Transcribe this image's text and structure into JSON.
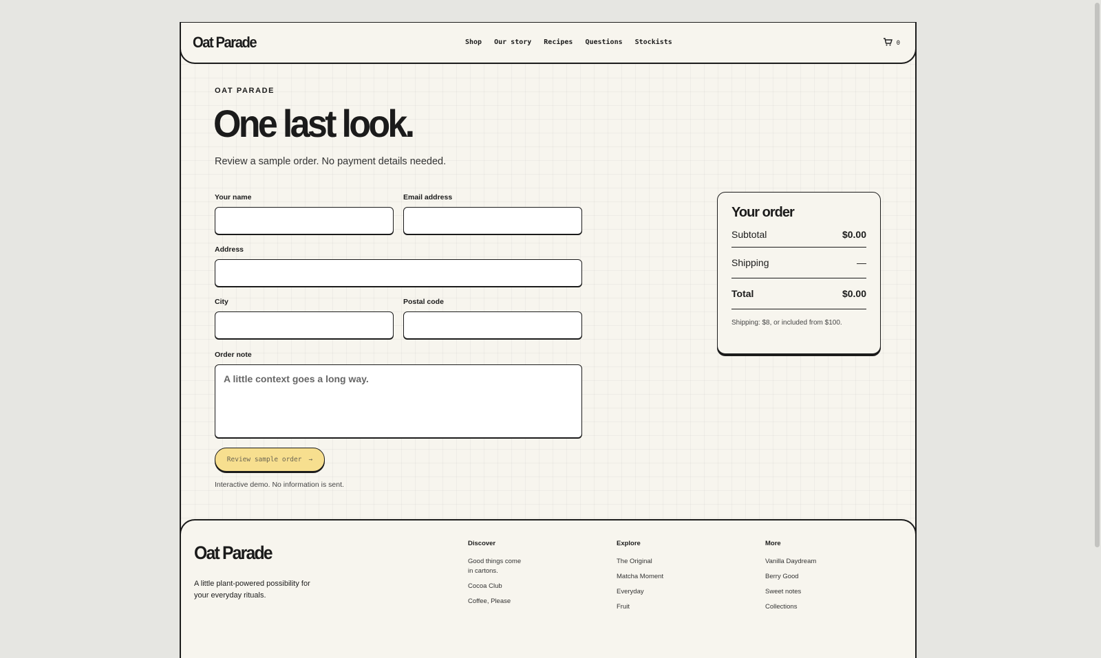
{
  "header": {
    "logo": "Oat Parade",
    "nav": [
      "Shop",
      "Our story",
      "Recipes",
      "Questions",
      "Stockists"
    ],
    "cart_count": "0"
  },
  "checkout": {
    "eyebrow": "OAT PARADE",
    "title": "One last look.",
    "subtitle": "Review a sample order. No payment details needed.",
    "fields": {
      "name_label": "Your name",
      "email_label": "Email address",
      "address_label": "Address",
      "city_label": "City",
      "postal_label": "Postal code",
      "note_label": "Order note",
      "note_placeholder": "A little context goes a long way."
    },
    "submit_label": "Review sample order",
    "submit_arrow": "→",
    "demo_note": "Interactive demo. No information is sent."
  },
  "order": {
    "title": "Your order",
    "subtotal_label": "Subtotal",
    "subtotal_value": "$0.00",
    "shipping_label": "Shipping",
    "shipping_value": "—",
    "total_label": "Total",
    "total_value": "$0.00",
    "shipping_note": "Shipping: $8, or included from $100."
  },
  "footer": {
    "logo": "Oat Parade",
    "tagline": "A little plant-powered possibility for your everyday rituals.",
    "columns": [
      {
        "heading": "Discover",
        "links": [
          "Good things come in cartons.",
          "Cocoa Club",
          "Coffee, Please"
        ]
      },
      {
        "heading": "Explore",
        "links": [
          "The Original",
          "Matcha Moment",
          "Everyday",
          "Fruit"
        ]
      },
      {
        "heading": "More",
        "links": [
          "Vanilla Daydream",
          "Berry Good",
          "Sweet notes",
          "Collections"
        ]
      }
    ]
  }
}
